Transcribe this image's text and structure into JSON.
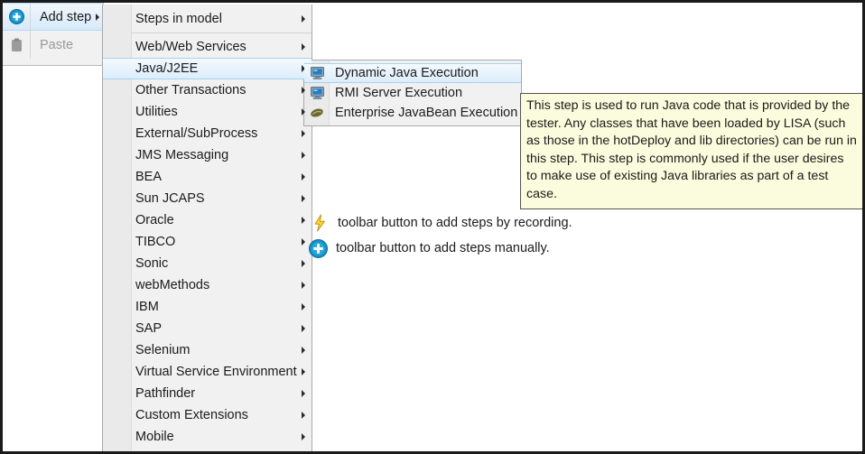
{
  "context_menu": {
    "items": [
      {
        "label": "Add step",
        "icon": "add-plus-circle-icon",
        "has_submenu": true,
        "highlighted": true,
        "disabled": false
      },
      {
        "label": "Paste",
        "icon": "clipboard-icon",
        "has_submenu": false,
        "highlighted": false,
        "disabled": true
      }
    ]
  },
  "main_menu": {
    "items": [
      {
        "label": "Steps in model",
        "has_submenu": true,
        "selected": false
      },
      {
        "label": "Web/Web Services",
        "has_submenu": true,
        "selected": false
      },
      {
        "label": "Java/J2EE",
        "has_submenu": true,
        "selected": true
      },
      {
        "label": "Other Transactions",
        "has_submenu": true,
        "selected": false
      },
      {
        "label": "Utilities",
        "has_submenu": true,
        "selected": false
      },
      {
        "label": "External/SubProcess",
        "has_submenu": true,
        "selected": false
      },
      {
        "label": "JMS Messaging",
        "has_submenu": true,
        "selected": false
      },
      {
        "label": "BEA",
        "has_submenu": true,
        "selected": false
      },
      {
        "label": "Sun JCAPS",
        "has_submenu": true,
        "selected": false
      },
      {
        "label": "Oracle",
        "has_submenu": true,
        "selected": false
      },
      {
        "label": "TIBCO",
        "has_submenu": true,
        "selected": false
      },
      {
        "label": "Sonic",
        "has_submenu": true,
        "selected": false
      },
      {
        "label": "webMethods",
        "has_submenu": true,
        "selected": false
      },
      {
        "label": "IBM",
        "has_submenu": true,
        "selected": false
      },
      {
        "label": "SAP",
        "has_submenu": true,
        "selected": false
      },
      {
        "label": "Selenium",
        "has_submenu": true,
        "selected": false
      },
      {
        "label": "Virtual Service Environment",
        "has_submenu": true,
        "selected": false
      },
      {
        "label": "Pathfinder",
        "has_submenu": true,
        "selected": false
      },
      {
        "label": "Custom Extensions",
        "has_submenu": true,
        "selected": false
      },
      {
        "label": "Mobile",
        "has_submenu": true,
        "selected": false
      }
    ],
    "divider_after_index": 0
  },
  "submenu": {
    "items": [
      {
        "label": "Dynamic Java Execution",
        "icon": "monitor-screen-icon",
        "selected": true
      },
      {
        "label": "RMI Server Execution",
        "icon": "monitor-screen-icon",
        "selected": false
      },
      {
        "label": "Enterprise JavaBean Execution",
        "icon": "java-bean-icon",
        "selected": false
      }
    ]
  },
  "tooltip": {
    "text": "This step is used to run Java code that is provided by the tester. Any classes that have been loaded by LISA (such as those in the hotDeploy and lib directories) can be run in this step. This step is commonly used if the user desires to make use of existing Java libraries as part of a test case."
  },
  "annotations": [
    {
      "icon": "lightning-bolt-icon",
      "text": "toolbar button to add steps by recording."
    },
    {
      "icon": "add-plus-circle-icon",
      "text": "toolbar button to add steps manually."
    }
  ],
  "colors": {
    "menu_background": "#f1f1f1",
    "menu_gutter": "#eaeaea",
    "highlight_blue": "#dcedfb",
    "highlight_border": "#a8d3f0",
    "tooltip_background": "#fbfbdd",
    "tooltip_border": "#555555",
    "text": "#1b1b1b",
    "disabled_text": "#9a9a9a",
    "accent_blue": "#1591c8",
    "bolt_yellow": "#ffd52e",
    "bean_green": "#6b6a2c"
  }
}
